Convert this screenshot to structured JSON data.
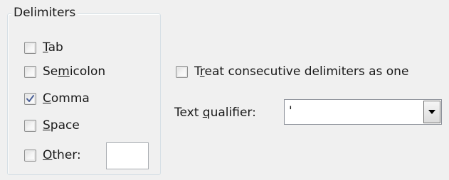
{
  "delimiters": {
    "group_label": "Delimiters",
    "options": [
      {
        "pre": "",
        "mnemonic": "T",
        "post": "ab",
        "checked": false
      },
      {
        "pre": "Se",
        "mnemonic": "m",
        "post": "icolon",
        "checked": false
      },
      {
        "pre": "",
        "mnemonic": "C",
        "post": "omma",
        "checked": true
      },
      {
        "pre": "",
        "mnemonic": "S",
        "post": "pace",
        "checked": false
      },
      {
        "pre": "",
        "mnemonic": "O",
        "post": "ther:",
        "checked": false
      }
    ],
    "other_value": ""
  },
  "consecutive": {
    "pre": "T",
    "mnemonic": "r",
    "post": "eat consecutive delimiters as one",
    "checked": false
  },
  "qualifier": {
    "label_pre": "Text ",
    "label_mnemonic": "q",
    "label_post": "ualifier:",
    "value": "'"
  },
  "colors": {
    "checkmark": "#4a5f97",
    "dropdown_arrow": "#000000"
  },
  "icons": {
    "checkmark": "checkmark-icon",
    "dropdown": "chevron-down-icon"
  }
}
